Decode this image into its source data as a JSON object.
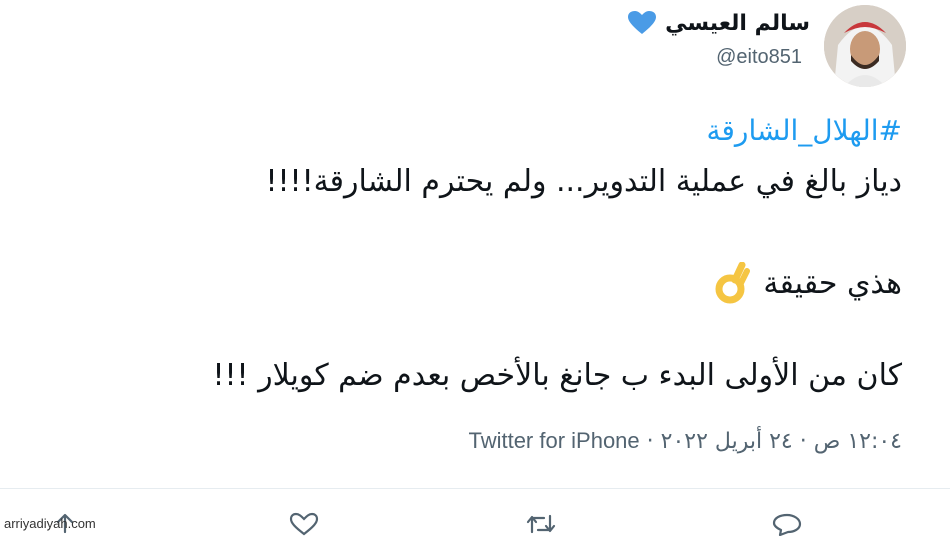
{
  "user": {
    "name": "سالم العيسي",
    "handle": "@eito851",
    "badge_color": "#4a9be6"
  },
  "tweet": {
    "hashtag": "#الهلال_الشارقة",
    "line1": "دياز بالغ في عملية التدوير... ولم يحترم الشارقة!!!!",
    "line2": "هذي حقيقة",
    "line2_emoji": "ok-hand-emoji",
    "line3": "كان من الأولى البدء ب جانغ بالأخص بعدم ضم كويلار !!!"
  },
  "meta": {
    "time": "١٢:٠٤ ص",
    "date": "٢٤ أبريل ٢٠٢٢",
    "separator": "·",
    "source": "Twitter for iPhone"
  },
  "actions": [
    "share-icon",
    "like-icon",
    "retweet-icon",
    "reply-icon"
  ],
  "watermark": "arriyadiyah.com",
  "colors": {
    "link": "#1d9bf0",
    "muted": "#536471",
    "text": "#0f1419"
  }
}
